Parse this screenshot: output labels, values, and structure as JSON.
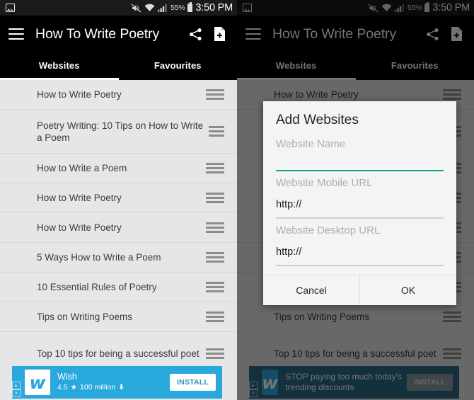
{
  "status_bar": {
    "gallery_icon": "gallery-icon",
    "mute_icon": "vibrate-mute-icon",
    "wifi_icon": "wifi-icon",
    "signal_icon": "signal-bars-icon",
    "battery_percent": "55%",
    "battery_icon": "battery-icon",
    "time": "3:50 PM"
  },
  "app_bar": {
    "menu_icon": "hamburger-menu-icon",
    "title": "How To Write Poetry",
    "share_icon": "share-icon",
    "add_icon": "add-document-icon"
  },
  "tabs": {
    "items": [
      {
        "label": "Websites",
        "selected": true
      },
      {
        "label": "Favourites",
        "selected": false
      }
    ]
  },
  "list": {
    "drag_handle_icon": "drag-handle-icon",
    "rows": [
      {
        "text": "How to Write Poetry",
        "lines": 1
      },
      {
        "text": "Poetry Writing: 10 Tips on How to Write a Poem",
        "lines": 2
      },
      {
        "text": "How to Write a Poem",
        "lines": 1
      },
      {
        "text": "How to Write Poetry",
        "lines": 1
      },
      {
        "text": "How to Write Poetry",
        "lines": 1
      },
      {
        "text": "5 Ways How to Write a Poem",
        "lines": 1
      },
      {
        "text": "10 Essential Rules of Poetry",
        "lines": 1
      },
      {
        "text": "Tips on Writing Poems",
        "lines": 1
      },
      {
        "text": "Top 10 tips for being a successful poet",
        "lines": 2
      }
    ]
  },
  "ad_left": {
    "adchoices_icon": "adchoices-icon",
    "close_icon": "close-icon",
    "logo_glyph": "w",
    "title": "Wish",
    "rating": "4.5",
    "star_icon": "star-icon",
    "downloads": "100 million",
    "download_icon": "download-icon",
    "install_label": "INSTALL",
    "background_color": "#29a8dd"
  },
  "ad_right": {
    "adchoices_icon": "adchoices-icon",
    "close_icon": "close-icon",
    "logo_glyph": "w",
    "title": "STOP paying too much today's trending discounts",
    "install_label": "INSTALL"
  },
  "dialog": {
    "title": "Add Websites",
    "accent_color": "#13a196",
    "fields": [
      {
        "label": "Website Name",
        "value": "",
        "focused": true
      },
      {
        "label": "Website Mobile URL",
        "value": "http://",
        "focused": false
      },
      {
        "label": "Website Desktop URL",
        "value": "http://",
        "focused": false
      }
    ],
    "cancel_label": "Cancel",
    "ok_label": "OK"
  }
}
